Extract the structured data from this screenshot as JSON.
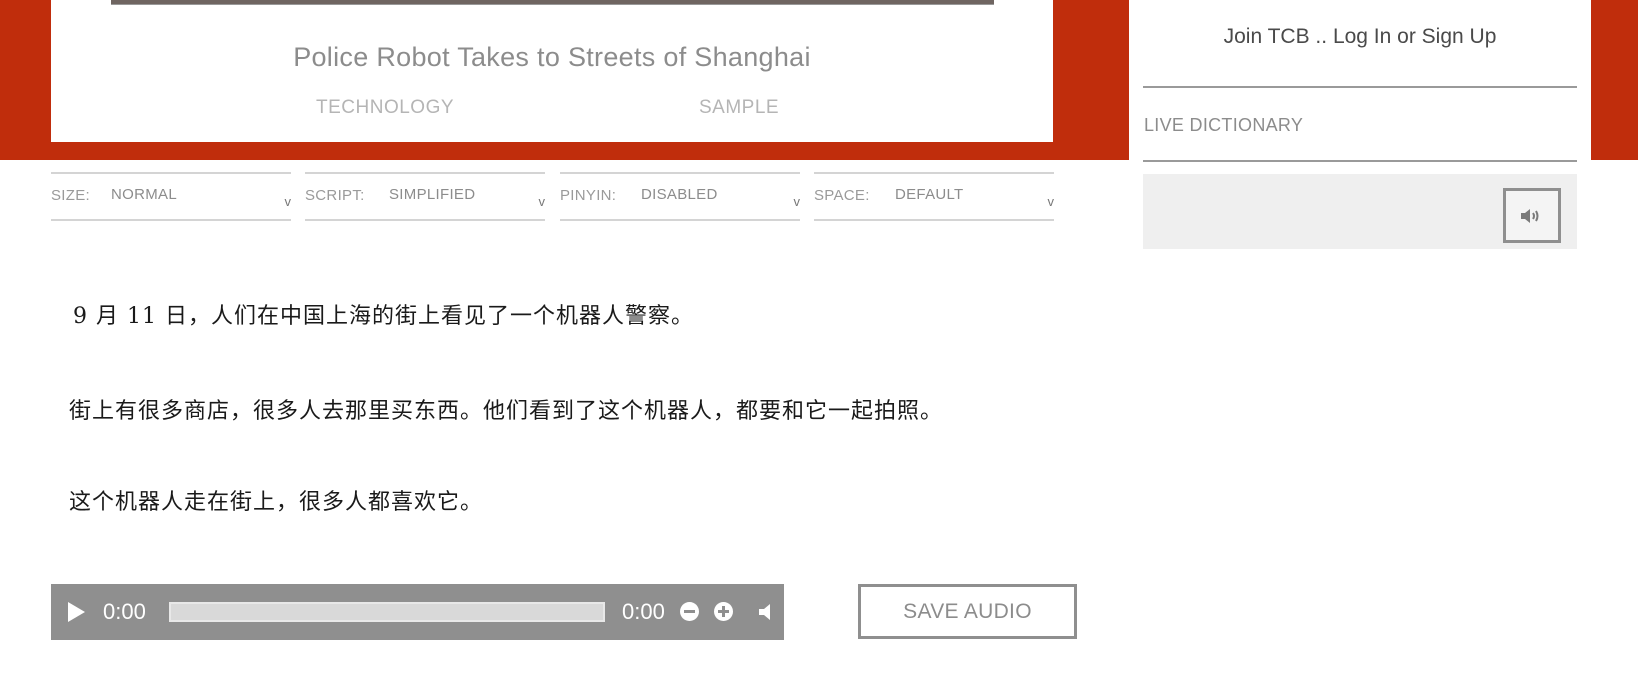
{
  "article": {
    "title": "Police Robot Takes to Streets of Shanghai",
    "tags": [
      "TECHNOLOGY",
      "SAMPLE"
    ]
  },
  "settings": [
    {
      "label": "SIZE:",
      "value": "NORMAL"
    },
    {
      "label": "SCRIPT:",
      "value": "SIMPLIFIED"
    },
    {
      "label": "PINYIN:",
      "value": "DISABLED"
    },
    {
      "label": "SPACE:",
      "value": "DEFAULT"
    }
  ],
  "paragraphs": [
    "9 月 11 日，人们在中国上海的街上看见了一个机器人警察。",
    "街上有很多商店，很多人去那里买东西。他们看到了这个机器人，都要和它一起拍照。",
    "这个机器人走在街上，很多人都喜欢它。"
  ],
  "player": {
    "current_time": "0:00",
    "duration": "0:00",
    "progress": 0
  },
  "save_audio_label": "SAVE AUDIO",
  "sidebar": {
    "join_prefix": "Join TCB .. ",
    "login": "Log In",
    "or": " or ",
    "signup": "Sign Up",
    "live_dictionary": "LIVE DICTIONARY"
  },
  "icons": {
    "play": "play-icon",
    "zoom_out": "minus-circle-icon",
    "zoom_in": "plus-circle-icon",
    "volume": "volume-icon",
    "dict_speaker": "speaker-icon",
    "chevron": "chevron-down-icon"
  },
  "colors": {
    "brand_red": "#c02d0c",
    "player_gray": "#8f8f8f"
  }
}
